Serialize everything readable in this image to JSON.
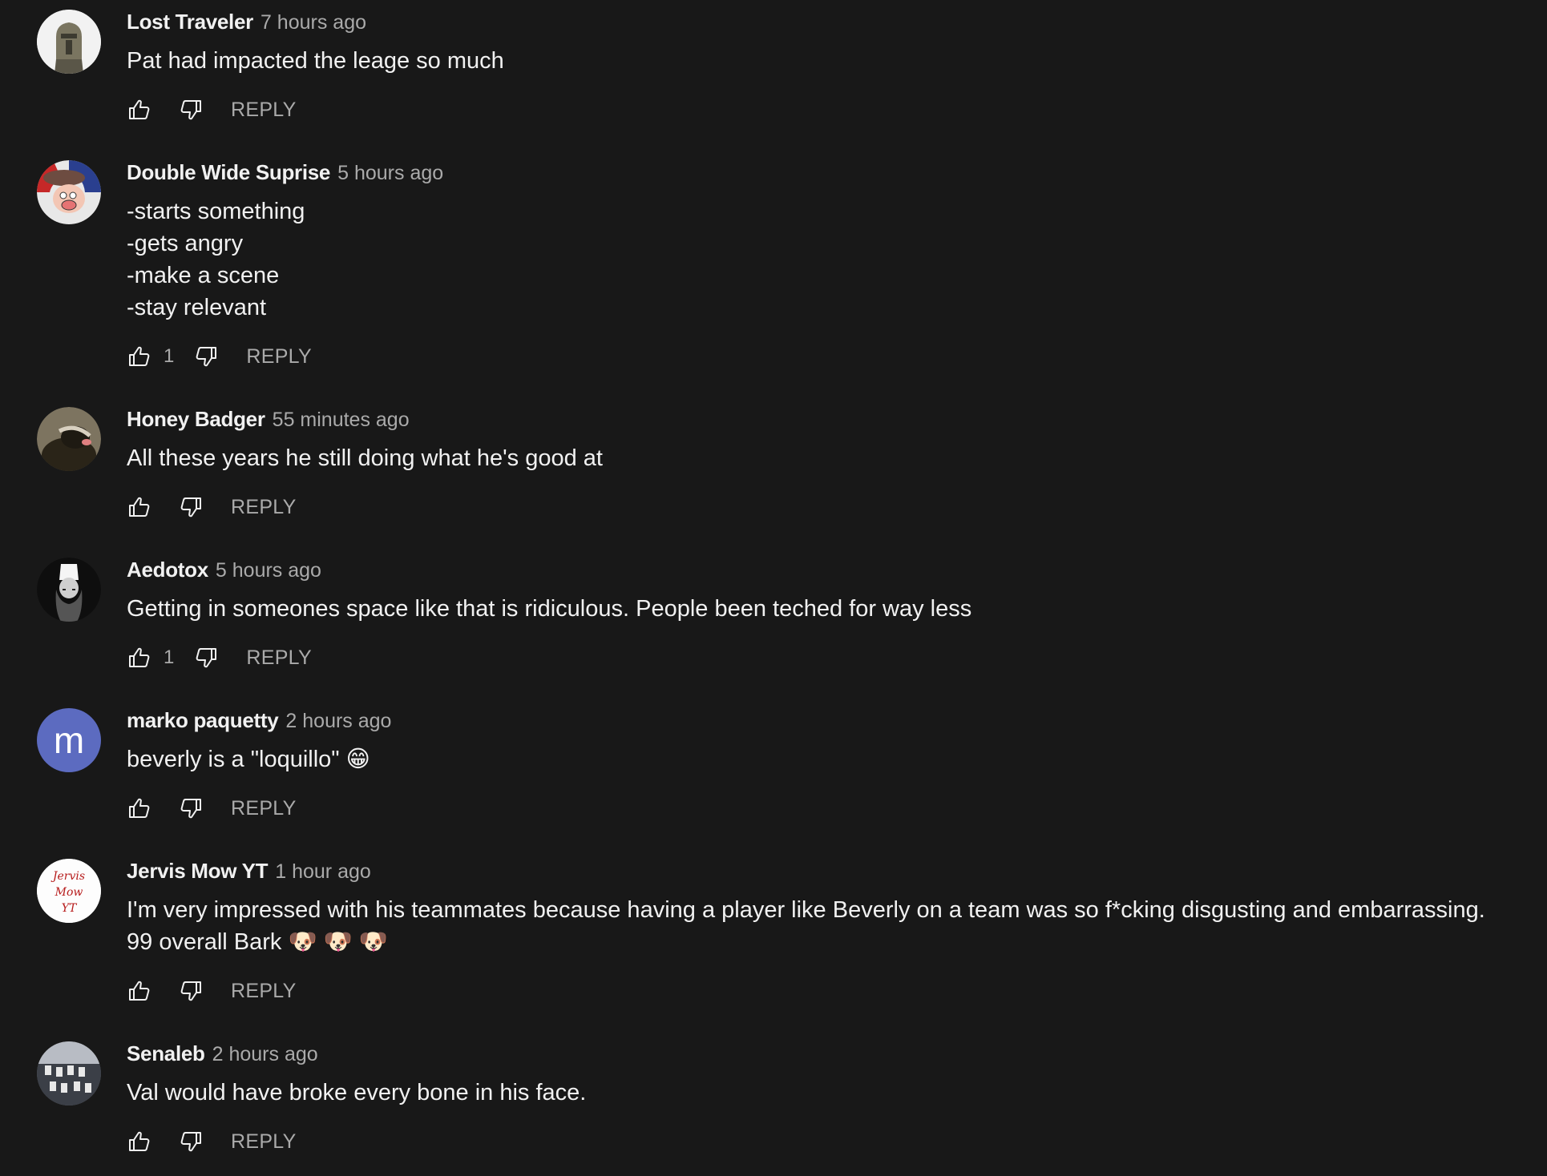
{
  "comments": [
    {
      "author": "Lost Traveler",
      "time": "7 hours ago",
      "lines": [
        "Pat had impacted the leage so much"
      ],
      "likes": "",
      "reply": "REPLY",
      "avatar": "helmet-avatar"
    },
    {
      "author": "Double Wide Suprise",
      "time": "5 hours ago",
      "lines": [
        "-starts something",
        "-gets angry",
        "-make a scene",
        "-stay relevant"
      ],
      "likes": "1",
      "reply": "REPLY",
      "avatar": "cartoon-avatar"
    },
    {
      "author": "Honey Badger",
      "time": "55 minutes ago",
      "lines": [
        "All these years he still doing what he's good at"
      ],
      "likes": "",
      "reply": "REPLY",
      "avatar": "badger-avatar"
    },
    {
      "author": "Aedotox",
      "time": "5 hours ago",
      "lines": [
        "Getting in someones space like that is ridiculous. People been teched for way less"
      ],
      "likes": "1",
      "reply": "REPLY",
      "avatar": "portrait-avatar"
    },
    {
      "author": "marko paquetty",
      "time": "2 hours ago",
      "lines": [
        "beverly is a \"loquillo\" 😁"
      ],
      "likes": "",
      "reply": "REPLY",
      "avatar": "m"
    },
    {
      "author": "Jervis Mow YT",
      "time": "1 hour ago",
      "lines": [
        "I'm very impressed with his teammates because having a player like Beverly on a team was so f*cking disgusting and embarrassing.",
        "99 overall Bark 🐶 🐶 🐶"
      ],
      "likes": "",
      "reply": "REPLY",
      "avatar": "signature-avatar"
    },
    {
      "author": "Senaleb",
      "time": "2 hours ago",
      "lines": [
        "Val would have broke every bone in his face."
      ],
      "likes": "",
      "reply": "REPLY",
      "avatar": "team-photo-avatar"
    }
  ],
  "signature_avatar_text": "Jervis Mow YT",
  "colors": {
    "background": "#181818",
    "text": "#f1f1f1",
    "secondary": "#aaaaaa",
    "letter_avatar": "#5c6bc0"
  }
}
